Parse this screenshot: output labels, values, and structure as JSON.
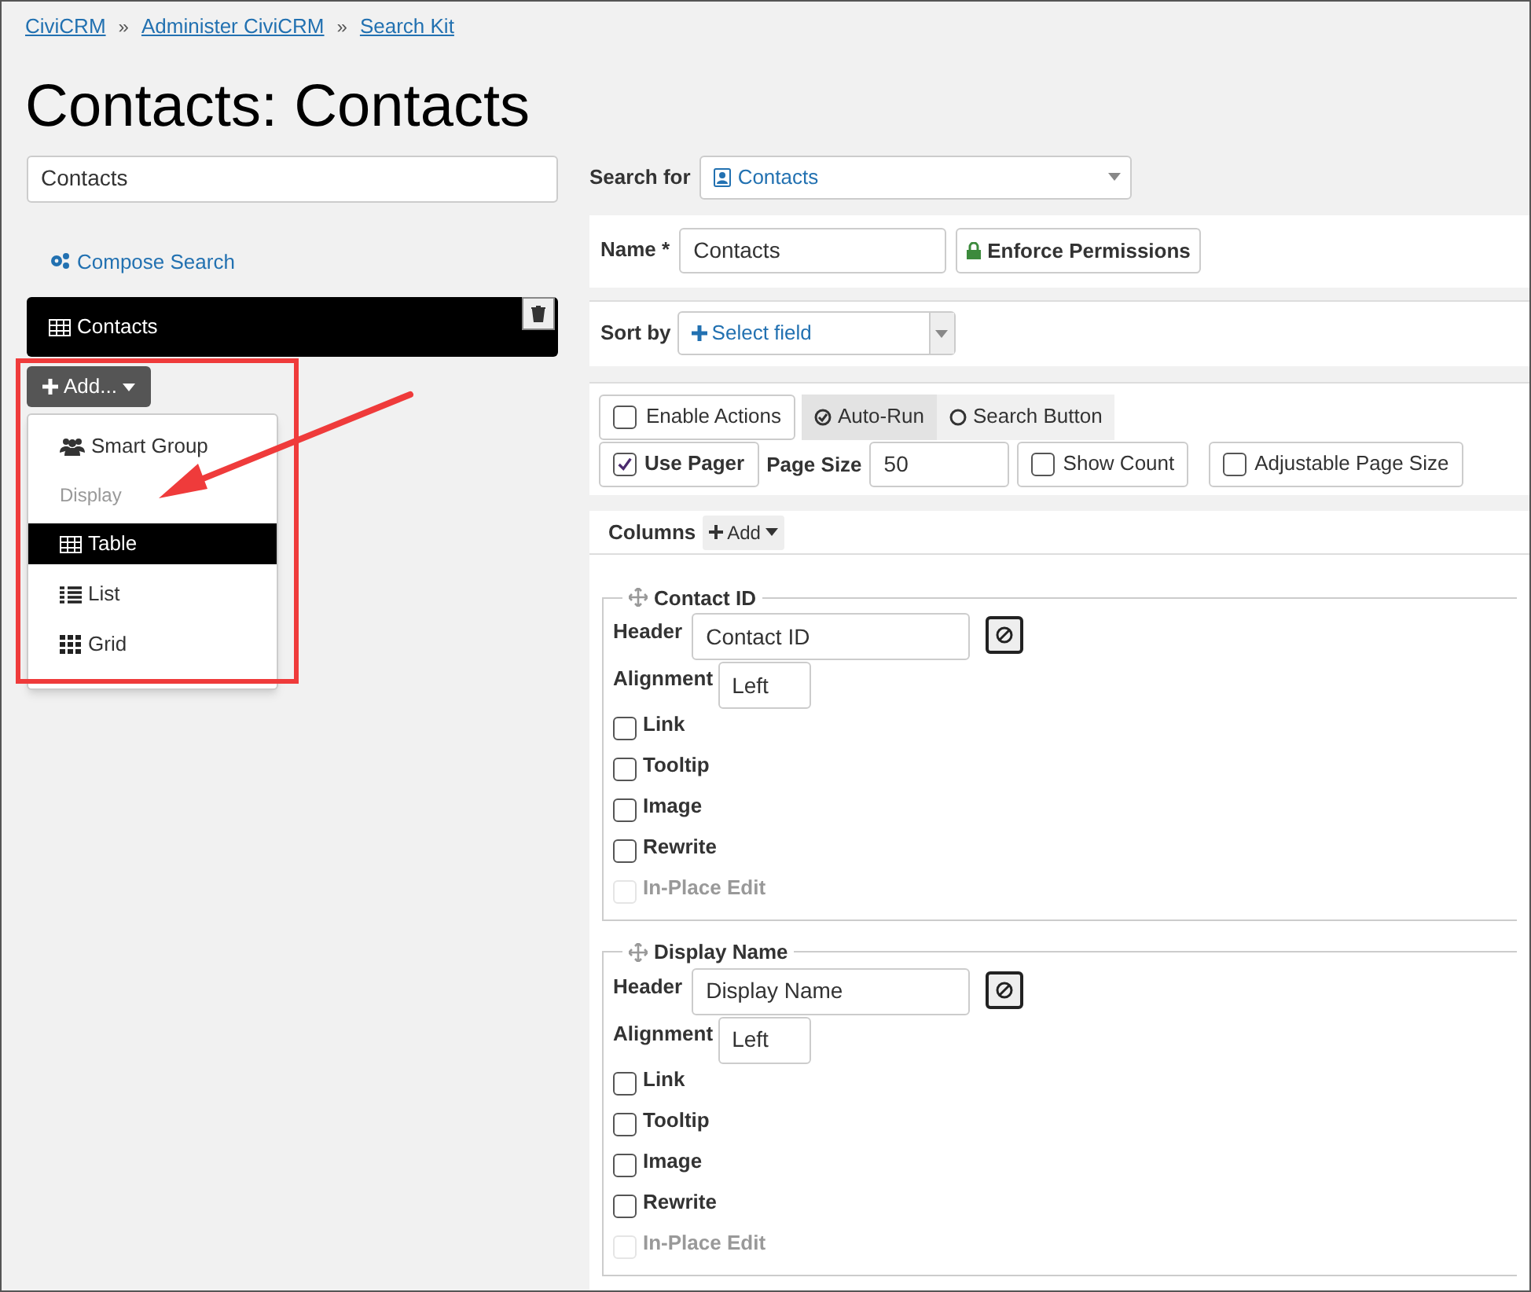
{
  "breadcrumbs": [
    "CiviCRM",
    "Administer CiviCRM",
    "Search Kit"
  ],
  "breadcrumb_separator": "»",
  "title": "Contacts: Contacts",
  "label_field": {
    "value": "Contacts"
  },
  "compose_link": "Compose Search",
  "displays": [
    {
      "label": "Contacts",
      "selected": true
    }
  ],
  "add_button": "Add...",
  "add_menu": [
    {
      "kind": "item",
      "label": "Smart Group",
      "selected": false
    },
    {
      "kind": "header",
      "label": "Display"
    },
    {
      "kind": "item",
      "label": "Table",
      "selected": true
    },
    {
      "kind": "item",
      "label": "List",
      "selected": false
    },
    {
      "kind": "item",
      "label": "Grid",
      "selected": false
    }
  ],
  "search_for": {
    "label": "Search for",
    "value": "Contacts"
  },
  "name": {
    "label": "Name *",
    "value": "Contacts"
  },
  "enforce_permissions": "Enforce Permissions",
  "sort_by": {
    "label": "Sort by",
    "placeholder": "Select field"
  },
  "enable_actions": {
    "label": "Enable Actions",
    "checked": false
  },
  "run_mode": [
    {
      "label": "Auto-Run",
      "selected": true
    },
    {
      "label": "Search Button",
      "selected": false
    }
  ],
  "use_pager": {
    "label": "Use Pager",
    "checked": true
  },
  "page_size": {
    "label": "Page Size",
    "value": "50"
  },
  "show_count": {
    "label": "Show Count",
    "checked": false
  },
  "adjustable_page_size": {
    "label": "Adjustable Page Size",
    "checked": false
  },
  "columns_label": "Columns",
  "columns_add": "Add",
  "columns": [
    {
      "title": "Contact ID",
      "header_label": "Header",
      "header_value": "Contact ID",
      "alignment_label": "Alignment",
      "alignment_value": "Left",
      "options": [
        {
          "label": "Link",
          "checked": false,
          "disabled": false
        },
        {
          "label": "Tooltip",
          "checked": false,
          "disabled": false
        },
        {
          "label": "Image",
          "checked": false,
          "disabled": false
        },
        {
          "label": "Rewrite",
          "checked": false,
          "disabled": false
        },
        {
          "label": "In-Place Edit",
          "checked": false,
          "disabled": true
        }
      ]
    },
    {
      "title": "Display Name",
      "header_label": "Header",
      "header_value": "Display Name",
      "alignment_label": "Alignment",
      "alignment_value": "Left",
      "options": [
        {
          "label": "Link",
          "checked": false,
          "disabled": false
        },
        {
          "label": "Tooltip",
          "checked": false,
          "disabled": false
        },
        {
          "label": "Image",
          "checked": false,
          "disabled": false
        },
        {
          "label": "Rewrite",
          "checked": false,
          "disabled": false
        },
        {
          "label": "In-Place Edit",
          "checked": false,
          "disabled": true
        }
      ]
    }
  ]
}
